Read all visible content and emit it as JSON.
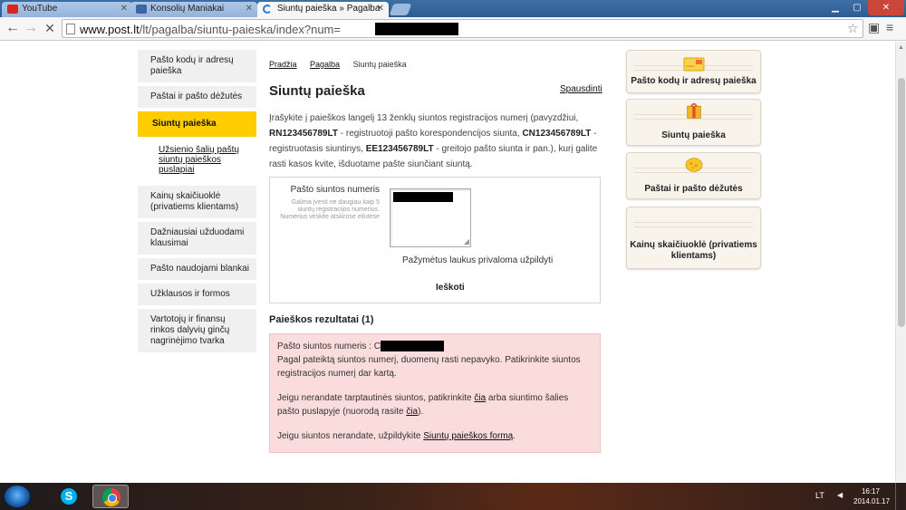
{
  "browser": {
    "tabs": [
      {
        "label": "YouTube",
        "state": "inactive"
      },
      {
        "label": "Konsolių Maniakai",
        "state": "inactive"
      },
      {
        "label": "Siuntų paieška » Pagalba",
        "state": "active"
      }
    ],
    "url_host": "www.post.lt",
    "url_path": "/lt/pagalba/siuntu-paieska/index?num="
  },
  "sidebar": {
    "items": [
      {
        "label": "Pašto kodų ir adresų paieška"
      },
      {
        "label": "Paštai ir pašto dėžutės"
      },
      {
        "label": "Siuntų paieška"
      },
      {
        "label": "Užsienio šalių paštų siuntų paieškos puslapiai"
      },
      {
        "label": "Kainų skaičiuoklė (privatiems klientams)"
      },
      {
        "label": "Dažniausiai užduodami klausimai"
      },
      {
        "label": "Pašto naudojami blankai"
      },
      {
        "label": "Užklausos ir formos"
      },
      {
        "label": "Vartotojų ir finansų rinkos dalyvių ginčų nagrinėjimo tvarka"
      }
    ]
  },
  "breadcrumb": {
    "home": "Pradžia",
    "section": "Pagalba",
    "current": "Siuntų paieška"
  },
  "main": {
    "title": "Siuntų paieška",
    "print_label": "Spausdinti",
    "intro_1": "Įrašykite į paieškos langelį 13 ženklų siuntos registracijos numerį (pavyzdžiui, ",
    "ex1": "RN123456789LT",
    "intro_2": " - registruotoji pašto korespondencijos siunta, ",
    "ex2": "CN123456789LT",
    "intro_3": " - registruotasis siuntinys, ",
    "ex3": "EE123456789LT",
    "intro_4": " - greitojo pašto siunta ir pan.), kurį galite rasti kasos kvite, išduotame pašte siunčiant siuntą."
  },
  "form": {
    "field_label": "Pašto siuntos numeris",
    "field_hint": "Galima įvesti ne daugiau kaip 5 siuntų registracijos numerius. Numerius veskite atskirose eilutėse",
    "required_note": "Pažymėtus laukus privaloma užpildyti",
    "submit_label": "Ieškoti"
  },
  "results": {
    "title": "Paieškos rezultatai (1)",
    "number_label": "Pašto siuntos numeris : C",
    "msg1": "Pagal pateiktą siuntos numerį, duomenų rasti nepavyko. Patikrinkite siuntos registracijos numerį dar kartą.",
    "msg2_a": "Jeigu nerandate tarptautinės siuntos, patikrinkite ",
    "link_cia1": "čia",
    "msg2_b": " arba siuntimo šalies pašto puslapyje (nuorodą rasite ",
    "link_cia2": "čia",
    "msg2_c": ").",
    "msg3_a": "Jeigu siuntos nerandate, užpildykite ",
    "link_form": "Siuntų paieškos formą",
    "msg3_b": "."
  },
  "quicklinks": [
    {
      "label": "Pašto kodų ir adresų paieška",
      "icon": "envelope-icon"
    },
    {
      "label": "Siuntų paieška",
      "icon": "parcel-icon"
    },
    {
      "label": "Paštai ir pašto dėžutės",
      "icon": "map-marker-icon"
    },
    {
      "label": "Kainų skaičiuoklė (privatiems klientams)",
      "icon": ""
    }
  ],
  "taskbar": {
    "language": "LT",
    "time": "16:17",
    "date": "2014.01.17"
  },
  "colors": {
    "accent": "#ffcc00",
    "error_bg": "#fbdcdc",
    "nav_bg": "#f0f0f0"
  }
}
